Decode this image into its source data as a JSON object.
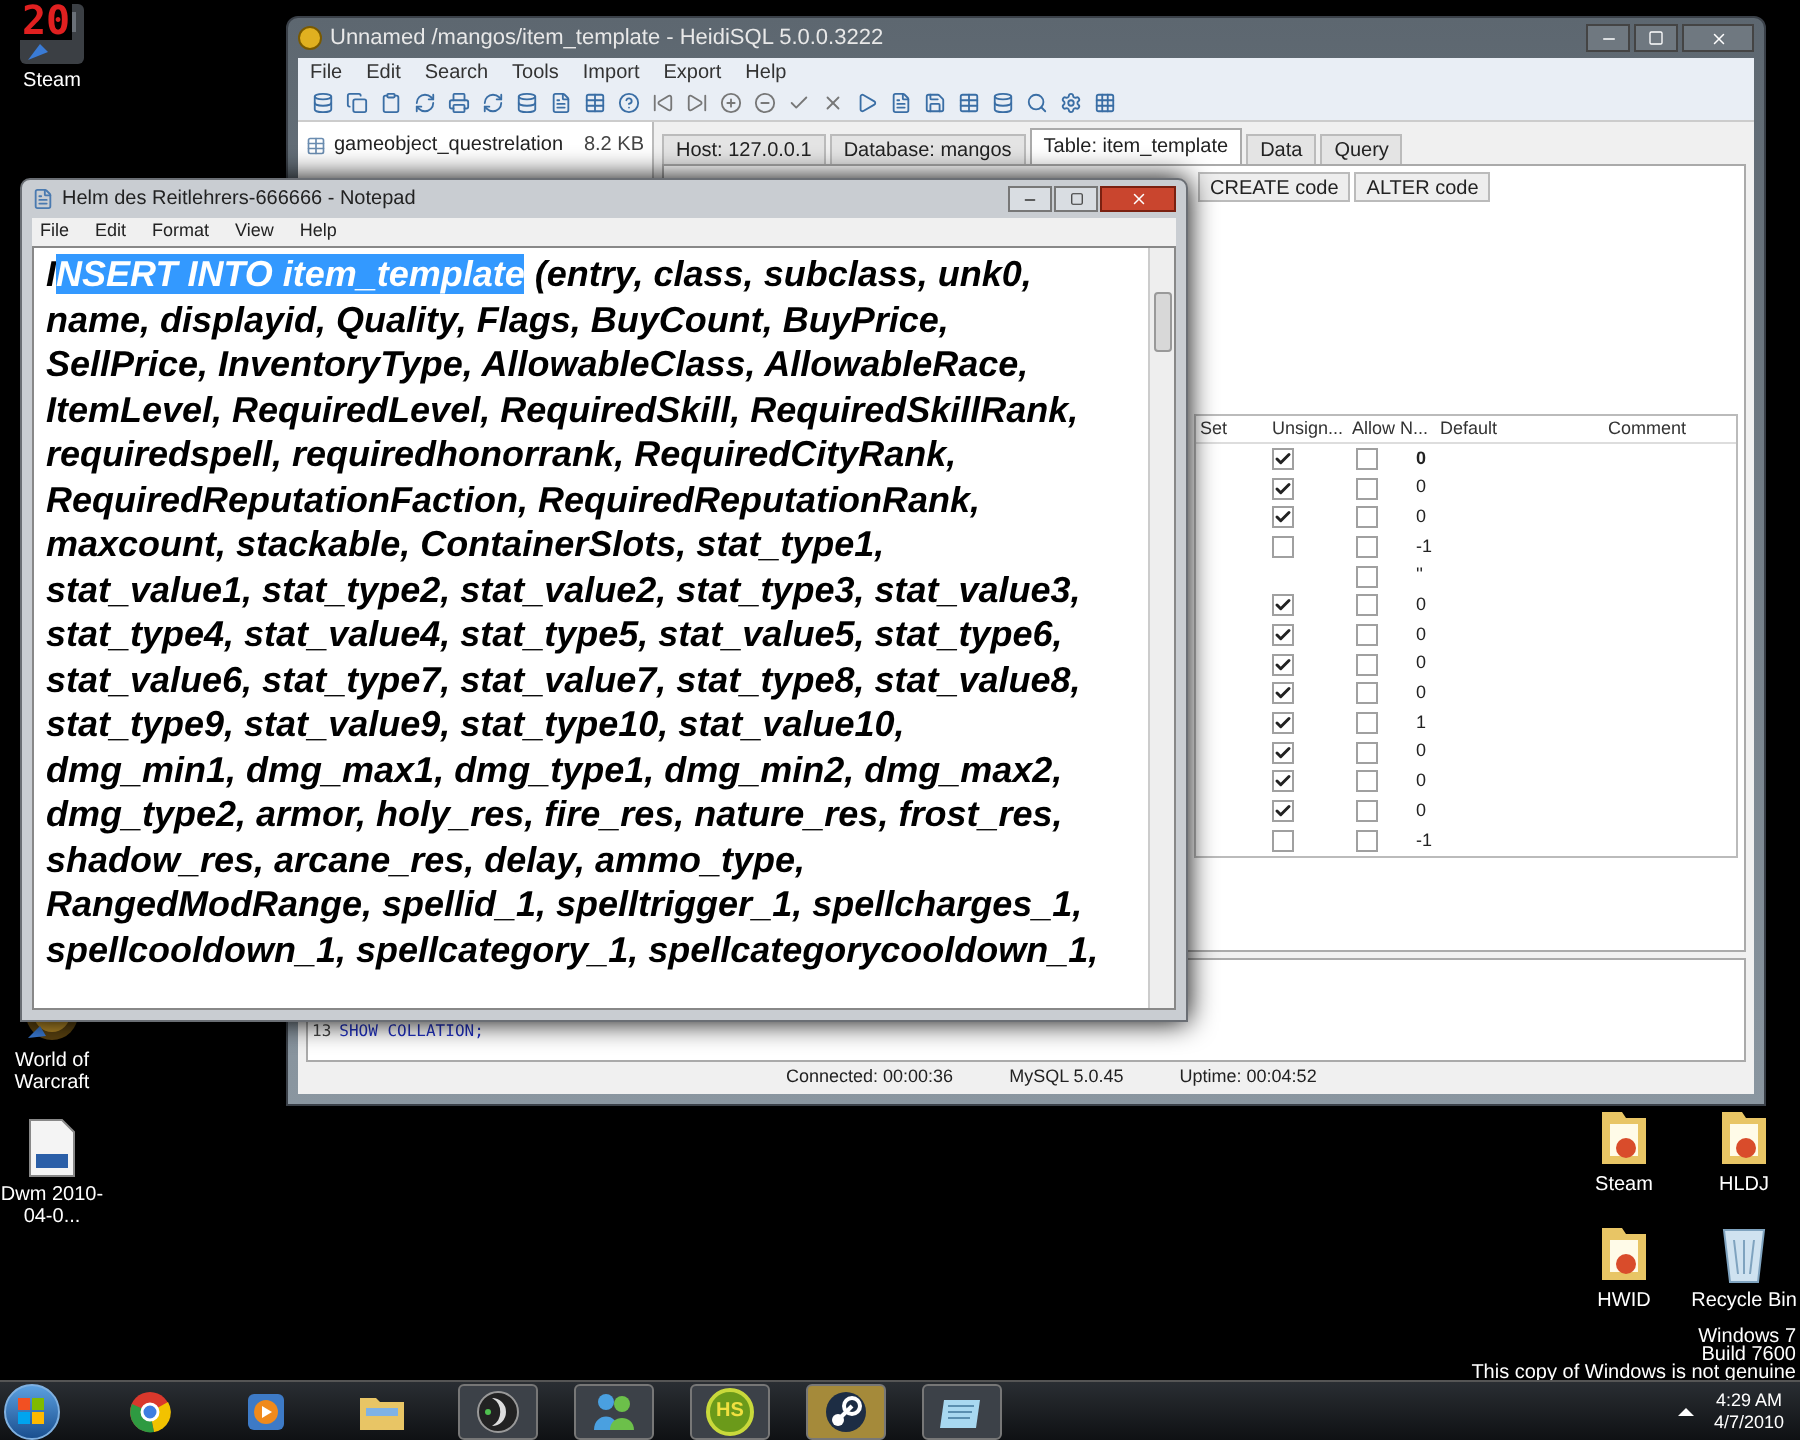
{
  "desktop_left": [
    {
      "kind": "game",
      "label": "Steam",
      "badge": "20"
    },
    {
      "kind": "warcraft",
      "label": "World of Warcraft"
    },
    {
      "kind": "video",
      "label": "Dwm 2010-04-0..."
    }
  ],
  "desktop_right": [
    {
      "kind": "folder",
      "label": "Steam"
    },
    {
      "kind": "folder",
      "label": "HLDJ"
    },
    {
      "kind": "folder",
      "label": "HWID"
    },
    {
      "kind": "recycle",
      "label": "Recycle Bin"
    }
  ],
  "heidisql": {
    "title": "Unnamed /mangos/item_template - HeidiSQL 5.0.0.3222",
    "menu": [
      "File",
      "Edit",
      "Search",
      "Tools",
      "Import",
      "Export",
      "Help"
    ],
    "tree": [
      {
        "name": "gameobject_questrelation",
        "size": "8.2 KB"
      }
    ],
    "tabs": [
      {
        "label": "Host: 127.0.0.1",
        "selected": false
      },
      {
        "label": "Database: mangos",
        "selected": false
      },
      {
        "label": "Table: item_template",
        "selected": true
      },
      {
        "label": "Data",
        "selected": false
      },
      {
        "label": "Query",
        "selected": false
      }
    ],
    "subtabs": [
      "CREATE code",
      "ALTER code"
    ],
    "columns": [
      "Set",
      "Unsign...",
      "Allow N...",
      "Default",
      "Comment"
    ],
    "rows": [
      {
        "unsigned": true,
        "allow_null": false,
        "default": "0"
      },
      {
        "unsigned": true,
        "allow_null": false,
        "default": "0"
      },
      {
        "unsigned": true,
        "allow_null": false,
        "default": "0"
      },
      {
        "unsigned": false,
        "allow_null": false,
        "default": "-1"
      },
      {
        "allow_null": false,
        "default": "''"
      },
      {
        "unsigned": true,
        "allow_null": false,
        "default": "0"
      },
      {
        "unsigned": true,
        "allow_null": false,
        "default": "0"
      },
      {
        "unsigned": true,
        "allow_null": false,
        "default": "0"
      },
      {
        "unsigned": true,
        "allow_null": false,
        "default": "0"
      },
      {
        "unsigned": true,
        "allow_null": false,
        "default": "1"
      },
      {
        "unsigned": true,
        "allow_null": false,
        "default": "0"
      },
      {
        "unsigned": true,
        "allow_null": false,
        "default": "0"
      },
      {
        "unsigned": true,
        "allow_null": false,
        "default": "0"
      },
      {
        "unsigned": false,
        "allow_null": false,
        "default": "-1"
      }
    ],
    "sql_log": [
      {
        "line": "13",
        "text": "SHOW COLLATION;"
      }
    ],
    "status_bar": [
      "Connected: 00:00:36",
      "MySQL 5.0.45",
      "Uptime: 00:04:52"
    ]
  },
  "notepad": {
    "title": "Helm des Reitlehrers-666666 - Notepad",
    "menu": [
      "File",
      "Edit",
      "Format",
      "View",
      "Help"
    ],
    "first_line": {
      "before": "I",
      "selected": "NSERT INTO item_template",
      "after": " (entry, class, subclass, unk0,"
    },
    "lines": [
      "name, displayid, Quality, Flags, BuyCount, BuyPrice,",
      "SellPrice, InventoryType, AllowableClass, AllowableRace,",
      "ItemLevel, RequiredLevel, RequiredSkill, RequiredSkillRank,",
      "requiredspell, requiredhonorrank, RequiredCityRank,",
      "RequiredReputationFaction, RequiredReputationRank,",
      "maxcount, stackable, ContainerSlots, stat_type1,",
      "stat_value1, stat_type2, stat_value2, stat_type3, stat_value3,",
      "stat_type4, stat_value4, stat_type5, stat_value5, stat_type6,",
      "stat_value6, stat_type7, stat_value7, stat_type8, stat_value8,",
      "stat_type9, stat_value9, stat_type10, stat_value10,",
      "dmg_min1, dmg_max1, dmg_type1, dmg_min2, dmg_max2,",
      "dmg_type2, armor, holy_res, fire_res, nature_res, frost_res,",
      "shadow_res, arcane_res, delay, ammo_type,",
      "RangedModRange, spellid_1, spelltrigger_1, spellcharges_1,",
      "spellcooldown_1, spellcategory_1, spellcategorycooldown_1,"
    ]
  },
  "notice": [
    "Windows 7",
    "Build 7600",
    "This copy of Windows is not genuine"
  ],
  "taskbar": [
    {
      "kind": "browser",
      "running": false,
      "active": false
    },
    {
      "kind": "media",
      "running": false,
      "active": false
    },
    {
      "kind": "explorer",
      "running": false,
      "active": false
    },
    {
      "kind": "app",
      "running": true,
      "active": false
    },
    {
      "kind": "messenger",
      "running": true,
      "active": false
    },
    {
      "kind": "hs",
      "label": "HS",
      "running": true,
      "active": false
    },
    {
      "kind": "steam",
      "running": true,
      "active": true
    },
    {
      "kind": "notepad",
      "running": true,
      "active": false
    }
  ],
  "clock": {
    "time": "4:29 AM",
    "date": "4/7/2010"
  }
}
